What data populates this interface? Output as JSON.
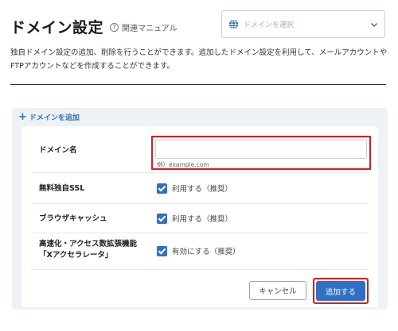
{
  "page": {
    "title": "ドメイン設定",
    "manual_label": "関連マニュアル",
    "help_glyph": "?",
    "domain_select_placeholder": "ドメインを選択",
    "description": "独自ドメイン設定の追加、削除を行うことができます。追加したドメイン設定を利用して、メールアカウントやFTPアカウントなどを作成することができます。"
  },
  "panel": {
    "add_link_label": "ドメインを追加",
    "add_link_glyph": "+"
  },
  "form": {
    "domain_name": {
      "label": "ドメイン名",
      "value": "",
      "hint": "例）example.com"
    },
    "free_ssl": {
      "label": "無料独自SSL",
      "checkbox_label": "利用する（推奨）",
      "checked": true
    },
    "browser_cache": {
      "label": "ブラウザキャッシュ",
      "checkbox_label": "利用する（推奨）",
      "checked": true
    },
    "acceleration": {
      "label_line1": "高速化・アクセス数拡張機能",
      "label_line2": "「Xアクセラレータ」",
      "checkbox_label": "有効にする（推奨）",
      "checked": true
    },
    "cancel_label": "キャンセル",
    "submit_label": "追加する"
  },
  "colors": {
    "accent": "#2f6fc4",
    "highlight": "#e21a1a",
    "panel_bg": "#eef1f5"
  },
  "icons": [
    "help-icon",
    "globe-icon",
    "chevron-down-icon",
    "plus-icon",
    "checkbox-checked-icon"
  ]
}
